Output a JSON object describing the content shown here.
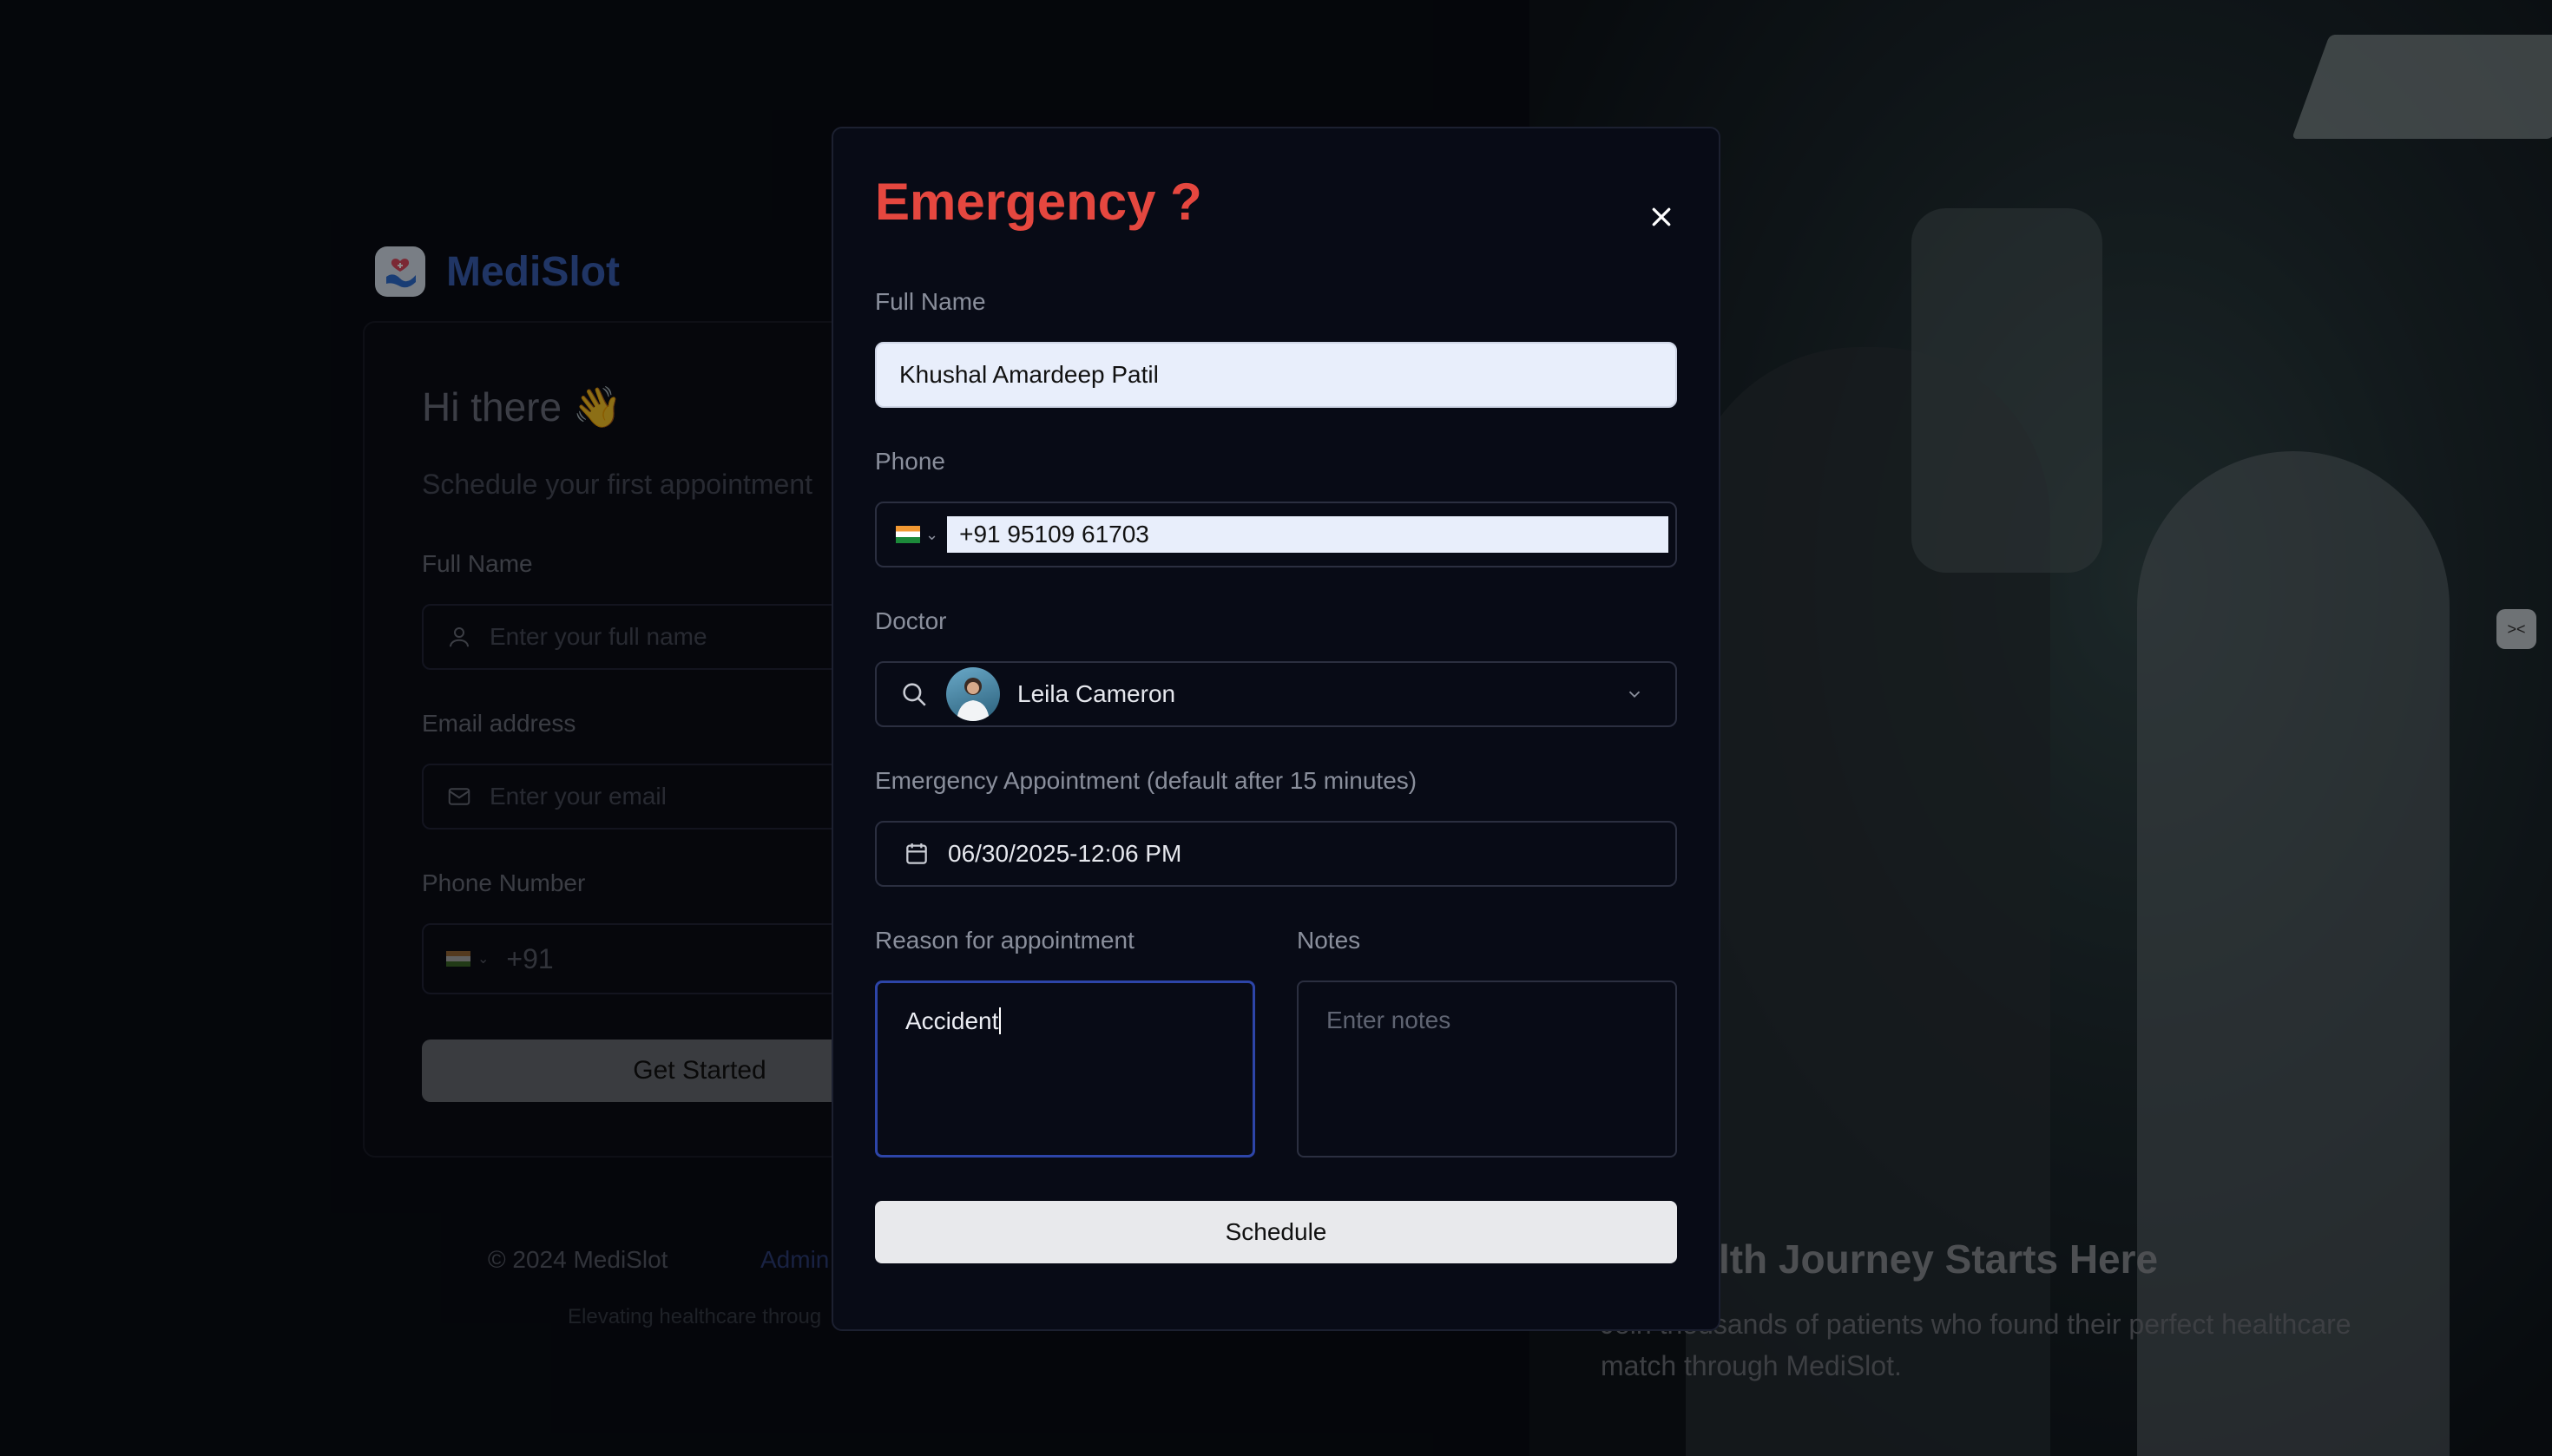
{
  "brand": {
    "name": "MediSlot"
  },
  "signup": {
    "greeting": "Hi there 👋",
    "subtitle": "Schedule your first appointment",
    "full_name_label": "Full Name",
    "full_name_placeholder": "Enter your full name",
    "email_label": "Email address",
    "email_placeholder": "Enter your email",
    "phone_label": "Phone Number",
    "phone_prefix": "+91",
    "get_started": "Get Started"
  },
  "footer": {
    "copyright": "© 2024 MediSlot",
    "admin_link": "Admin",
    "tagline": "Elevating healthcare throug"
  },
  "hero": {
    "title": "lealth Journey Starts Here",
    "description": "Join thousands of patients who found their perfect healthcare match through MediSlot."
  },
  "modal": {
    "title": "Emergency ?",
    "full_name_label": "Full Name",
    "full_name_value": "Khushal Amardeep Patil",
    "phone_label": "Phone",
    "phone_value": "+91 95109 61703",
    "doctor_label": "Doctor",
    "doctor_value": "Leila Cameron",
    "appointment_label": "Emergency Appointment (default after 15 minutes)",
    "appointment_value": "06/30/2025-12:06 PM",
    "reason_label": "Reason for appointment",
    "reason_value": "Accident",
    "notes_label": "Notes",
    "notes_placeholder": "Enter notes",
    "schedule_button": "Schedule"
  },
  "colors": {
    "emergency_title": "#e5473f",
    "brand": "#3b62b8",
    "focus_border": "#2d45a8"
  }
}
